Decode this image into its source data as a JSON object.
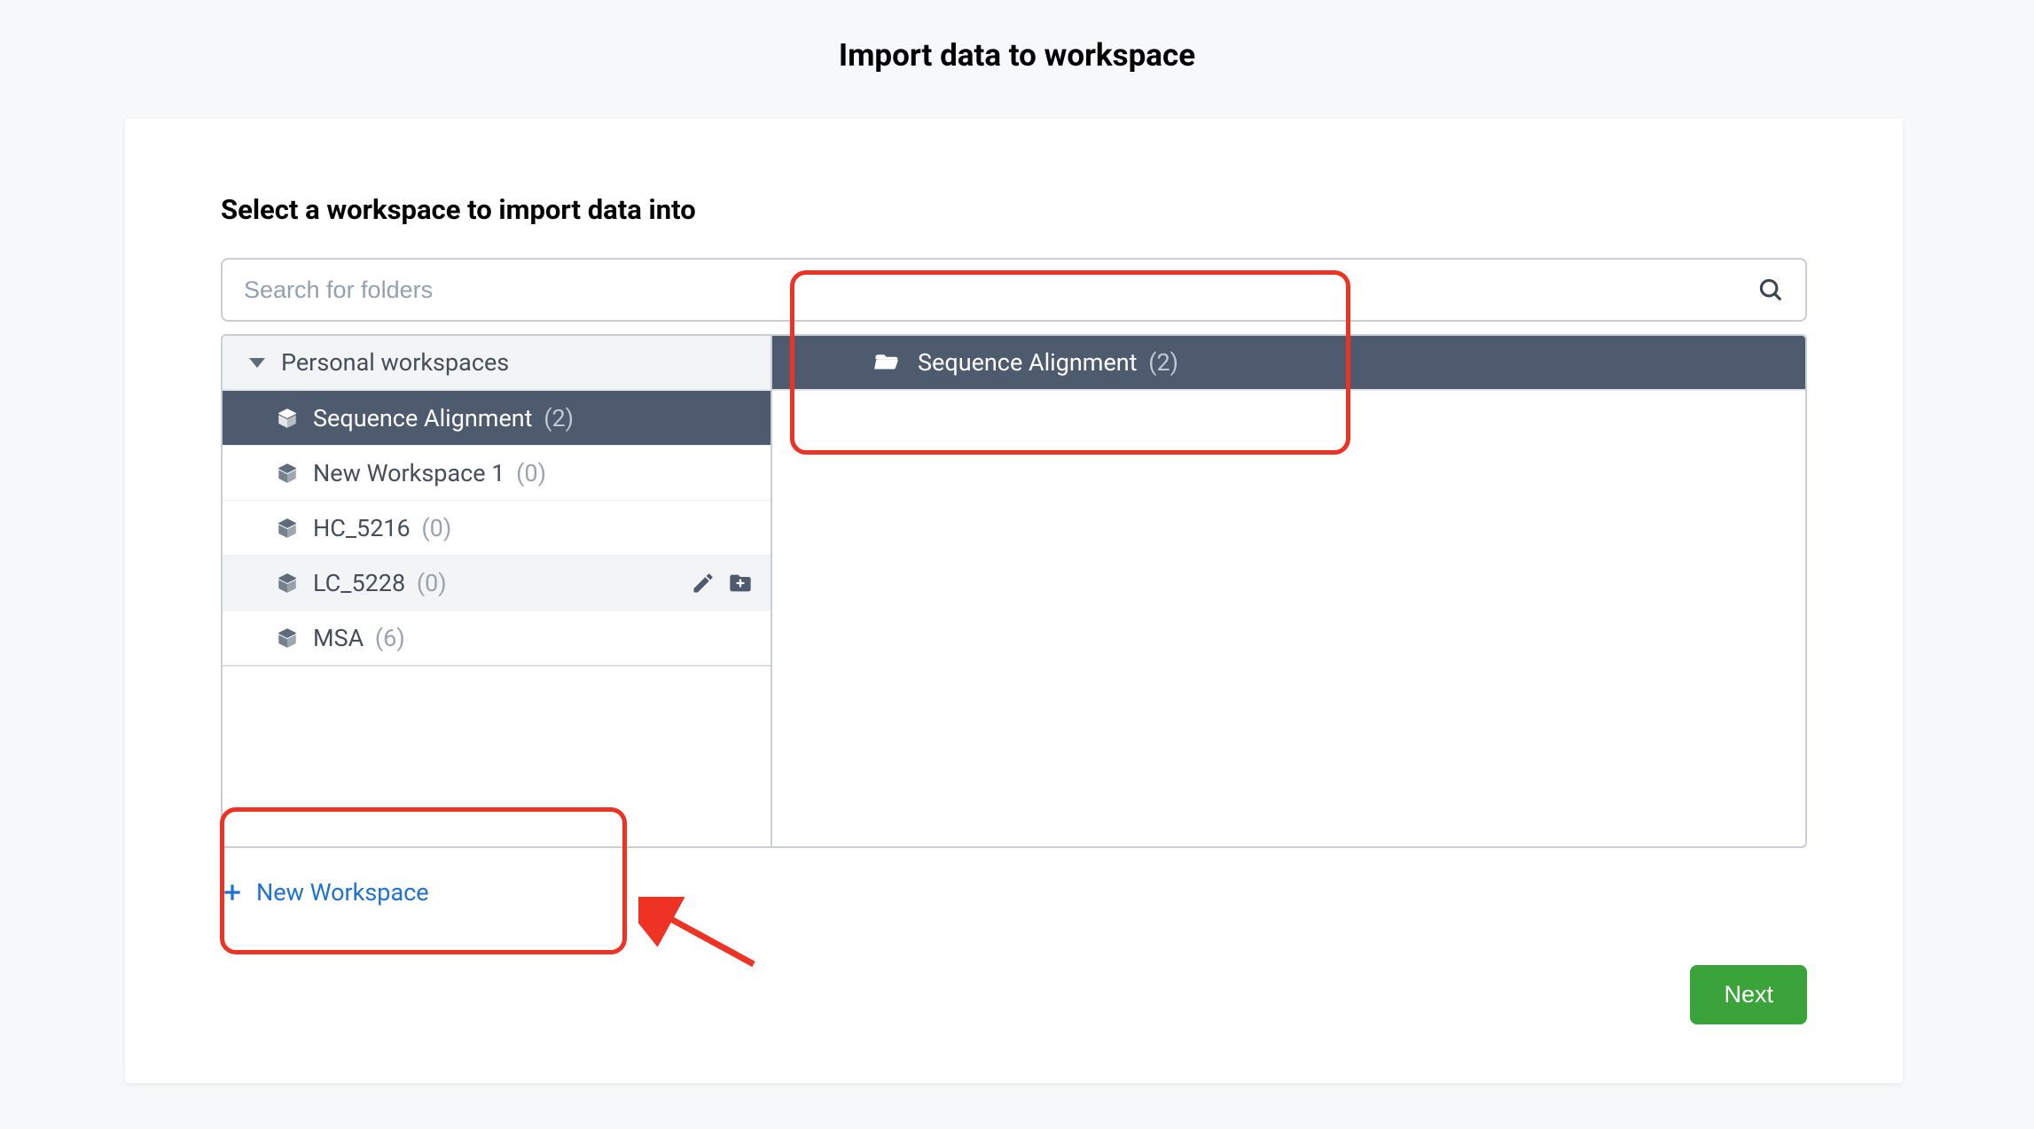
{
  "header": {
    "title": "Import data to workspace"
  },
  "section": {
    "subtitle": "Select a workspace to import data into"
  },
  "search": {
    "placeholder": "Search for folders"
  },
  "tree": {
    "root_label": "Personal workspaces",
    "items": [
      {
        "label": "Sequence Alignment",
        "count": "(2)",
        "selected": true
      },
      {
        "label": "New Workspace 1",
        "count": "(0)"
      },
      {
        "label": "HC_5216",
        "count": "(0)"
      },
      {
        "label": "LC_5228",
        "count": "(0)",
        "hovered": true
      },
      {
        "label": "MSA",
        "count": "(6)"
      }
    ]
  },
  "detail": {
    "label": "Sequence Alignment",
    "count": "(2)"
  },
  "actions": {
    "new_workspace_label": "New Workspace",
    "next_label": "Next"
  }
}
